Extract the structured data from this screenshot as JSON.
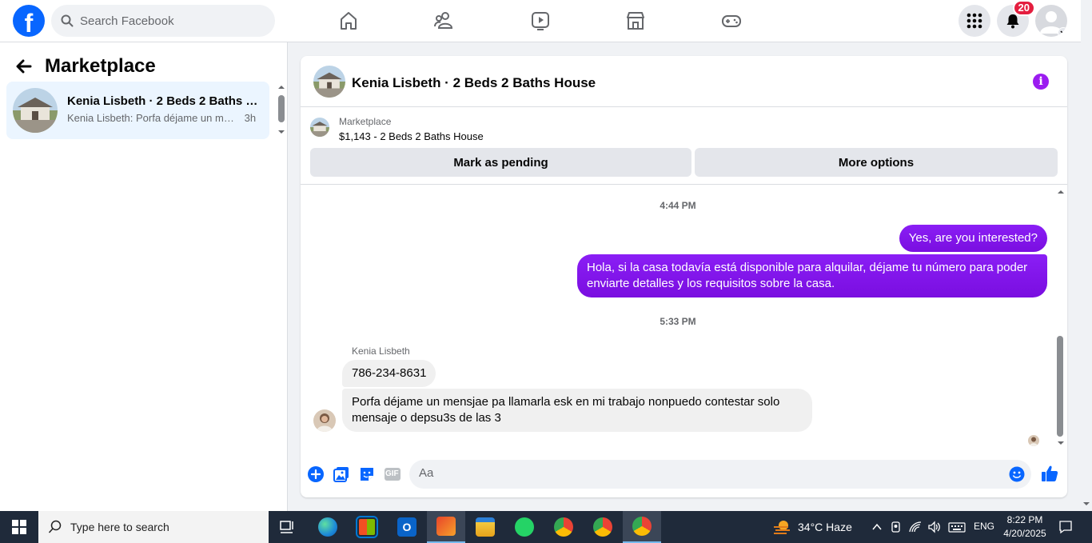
{
  "header": {
    "logo": "f",
    "search_placeholder": "Search Facebook",
    "notification_count": "20",
    "nav_icons": [
      "home-icon",
      "friends-icon",
      "video-icon",
      "marketplace-icon",
      "gaming-icon"
    ]
  },
  "sidebar": {
    "title": "Marketplace",
    "conversation": {
      "title": "Kenia Lisbeth · 2 Beds 2 Baths H...",
      "preview": "Kenia Lisbeth: Porfa déjame un me...",
      "time": "3h"
    }
  },
  "chat": {
    "title": "Kenia Lisbeth · 2 Beds 2 Baths House",
    "listing": {
      "label": "Marketplace",
      "price_title": "$1,143 - 2 Beds 2 Baths House",
      "mark_pending": "Mark as pending",
      "more_options": "More options"
    },
    "messages": {
      "ts1": "4:44 PM",
      "out1": "Yes, are you interested?",
      "out2_line1": "Hola, si la casa todavía está disponible para alquilar, déjame tu número para poder",
      "out2_line2": "enviarte detalles y los requisitos sobre la casa.",
      "ts2": "5:33 PM",
      "sender": "Kenia Lisbeth",
      "in1": "786-234-8631",
      "in2_line1": "Porfa déjame un mensjae pa llamarla esk en mi trabajo nonpuedo contestar solo",
      "in2_line2": "mensaje o depsu3s de las 3"
    },
    "composer": {
      "placeholder": "Aa",
      "gif": "GIF"
    }
  },
  "taskbar": {
    "search_placeholder": "Type here to search",
    "weather": "34°C  Haze",
    "language": "ENG",
    "time": "8:22 PM",
    "date": "4/20/2025"
  },
  "colors": {
    "facebook_blue": "#0866ff",
    "messenger_purple": "#8a1ef5",
    "notification_red": "#e41e3f"
  }
}
